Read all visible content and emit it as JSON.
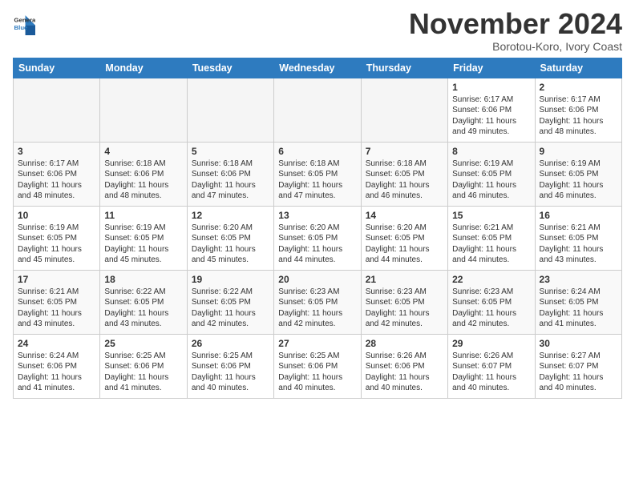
{
  "header": {
    "logo_line1": "General",
    "logo_line2": "Blue",
    "month_title": "November 2024",
    "location": "Borotou-Koro, Ivory Coast"
  },
  "weekdays": [
    "Sunday",
    "Monday",
    "Tuesday",
    "Wednesday",
    "Thursday",
    "Friday",
    "Saturday"
  ],
  "weeks": [
    [
      {
        "day": "",
        "empty": true
      },
      {
        "day": "",
        "empty": true
      },
      {
        "day": "",
        "empty": true
      },
      {
        "day": "",
        "empty": true
      },
      {
        "day": "",
        "empty": true
      },
      {
        "day": "1",
        "sunrise": "6:17 AM",
        "sunset": "6:06 PM",
        "daylight": "11 hours and 49 minutes."
      },
      {
        "day": "2",
        "sunrise": "6:17 AM",
        "sunset": "6:06 PM",
        "daylight": "11 hours and 48 minutes."
      }
    ],
    [
      {
        "day": "3",
        "sunrise": "6:17 AM",
        "sunset": "6:06 PM",
        "daylight": "11 hours and 48 minutes."
      },
      {
        "day": "4",
        "sunrise": "6:18 AM",
        "sunset": "6:06 PM",
        "daylight": "11 hours and 48 minutes."
      },
      {
        "day": "5",
        "sunrise": "6:18 AM",
        "sunset": "6:06 PM",
        "daylight": "11 hours and 47 minutes."
      },
      {
        "day": "6",
        "sunrise": "6:18 AM",
        "sunset": "6:05 PM",
        "daylight": "11 hours and 47 minutes."
      },
      {
        "day": "7",
        "sunrise": "6:18 AM",
        "sunset": "6:05 PM",
        "daylight": "11 hours and 46 minutes."
      },
      {
        "day": "8",
        "sunrise": "6:19 AM",
        "sunset": "6:05 PM",
        "daylight": "11 hours and 46 minutes."
      },
      {
        "day": "9",
        "sunrise": "6:19 AM",
        "sunset": "6:05 PM",
        "daylight": "11 hours and 46 minutes."
      }
    ],
    [
      {
        "day": "10",
        "sunrise": "6:19 AM",
        "sunset": "6:05 PM",
        "daylight": "11 hours and 45 minutes."
      },
      {
        "day": "11",
        "sunrise": "6:19 AM",
        "sunset": "6:05 PM",
        "daylight": "11 hours and 45 minutes."
      },
      {
        "day": "12",
        "sunrise": "6:20 AM",
        "sunset": "6:05 PM",
        "daylight": "11 hours and 45 minutes."
      },
      {
        "day": "13",
        "sunrise": "6:20 AM",
        "sunset": "6:05 PM",
        "daylight": "11 hours and 44 minutes."
      },
      {
        "day": "14",
        "sunrise": "6:20 AM",
        "sunset": "6:05 PM",
        "daylight": "11 hours and 44 minutes."
      },
      {
        "day": "15",
        "sunrise": "6:21 AM",
        "sunset": "6:05 PM",
        "daylight": "11 hours and 44 minutes."
      },
      {
        "day": "16",
        "sunrise": "6:21 AM",
        "sunset": "6:05 PM",
        "daylight": "11 hours and 43 minutes."
      }
    ],
    [
      {
        "day": "17",
        "sunrise": "6:21 AM",
        "sunset": "6:05 PM",
        "daylight": "11 hours and 43 minutes."
      },
      {
        "day": "18",
        "sunrise": "6:22 AM",
        "sunset": "6:05 PM",
        "daylight": "11 hours and 43 minutes."
      },
      {
        "day": "19",
        "sunrise": "6:22 AM",
        "sunset": "6:05 PM",
        "daylight": "11 hours and 42 minutes."
      },
      {
        "day": "20",
        "sunrise": "6:23 AM",
        "sunset": "6:05 PM",
        "daylight": "11 hours and 42 minutes."
      },
      {
        "day": "21",
        "sunrise": "6:23 AM",
        "sunset": "6:05 PM",
        "daylight": "11 hours and 42 minutes."
      },
      {
        "day": "22",
        "sunrise": "6:23 AM",
        "sunset": "6:05 PM",
        "daylight": "11 hours and 42 minutes."
      },
      {
        "day": "23",
        "sunrise": "6:24 AM",
        "sunset": "6:05 PM",
        "daylight": "11 hours and 41 minutes."
      }
    ],
    [
      {
        "day": "24",
        "sunrise": "6:24 AM",
        "sunset": "6:06 PM",
        "daylight": "11 hours and 41 minutes."
      },
      {
        "day": "25",
        "sunrise": "6:25 AM",
        "sunset": "6:06 PM",
        "daylight": "11 hours and 41 minutes."
      },
      {
        "day": "26",
        "sunrise": "6:25 AM",
        "sunset": "6:06 PM",
        "daylight": "11 hours and 40 minutes."
      },
      {
        "day": "27",
        "sunrise": "6:25 AM",
        "sunset": "6:06 PM",
        "daylight": "11 hours and 40 minutes."
      },
      {
        "day": "28",
        "sunrise": "6:26 AM",
        "sunset": "6:06 PM",
        "daylight": "11 hours and 40 minutes."
      },
      {
        "day": "29",
        "sunrise": "6:26 AM",
        "sunset": "6:07 PM",
        "daylight": "11 hours and 40 minutes."
      },
      {
        "day": "30",
        "sunrise": "6:27 AM",
        "sunset": "6:07 PM",
        "daylight": "11 hours and 40 minutes."
      }
    ]
  ]
}
